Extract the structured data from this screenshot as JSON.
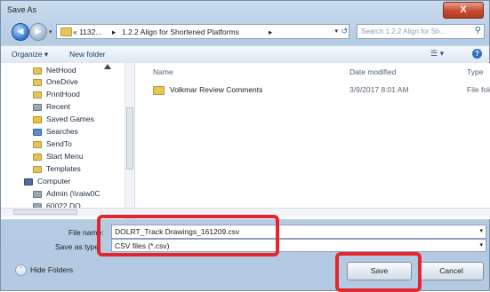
{
  "window": {
    "title": "Save As",
    "close_glyph": "X"
  },
  "address": {
    "segments": [
      "« 1132...",
      "▸",
      "1.2.2 Align for Shortened Platforms",
      "▸"
    ],
    "search_placeholder": "Search 1.2.2 Align for Sh..."
  },
  "toolbar": {
    "organize": "Organize ▾",
    "new_folder": "New folder",
    "view_icon": "☰ ▾",
    "help": "?"
  },
  "sidebar": {
    "items": [
      {
        "label": "NetHood",
        "icon": "folder-icon"
      },
      {
        "label": "OneDrive",
        "icon": "folder-icon"
      },
      {
        "label": "PrintHood",
        "icon": "folder-icon"
      },
      {
        "label": "Recent",
        "icon": "recent-icon"
      },
      {
        "label": "Saved Games",
        "icon": "saved-games-icon"
      },
      {
        "label": "Searches",
        "icon": "searches-icon"
      },
      {
        "label": "SendTo",
        "icon": "folder-icon"
      },
      {
        "label": "Start Menu",
        "icon": "folder-icon"
      },
      {
        "label": "Templates",
        "icon": "folder-icon"
      },
      {
        "label": "Computer",
        "icon": "computer-icon"
      },
      {
        "label": "Admin (\\\\raiw0C",
        "icon": "network-drive-icon"
      },
      {
        "label": "60022 DO",
        "icon": "network-drive-icon"
      }
    ]
  },
  "list": {
    "columns": {
      "name": "Name",
      "date_modified": "Date modified",
      "type": "Type"
    },
    "rows": [
      {
        "name": "Volkmar Review Comments",
        "date_modified": "3/9/2017 8:01 AM",
        "type": "File folde"
      }
    ]
  },
  "form": {
    "file_name_label": "File name:",
    "file_name_value": "DOLRT_Track Drawings_161209.csv",
    "save_type_label": "Save as type:",
    "save_type_value": "CSV files (*.csv)"
  },
  "buttons": {
    "hide_folders": "Hide Folders",
    "save": "Save",
    "cancel": "Cancel"
  },
  "colors": {
    "highlight": "#e3262d",
    "title_bar": "#c9dcef",
    "accent_blue": "#2f73c5"
  }
}
